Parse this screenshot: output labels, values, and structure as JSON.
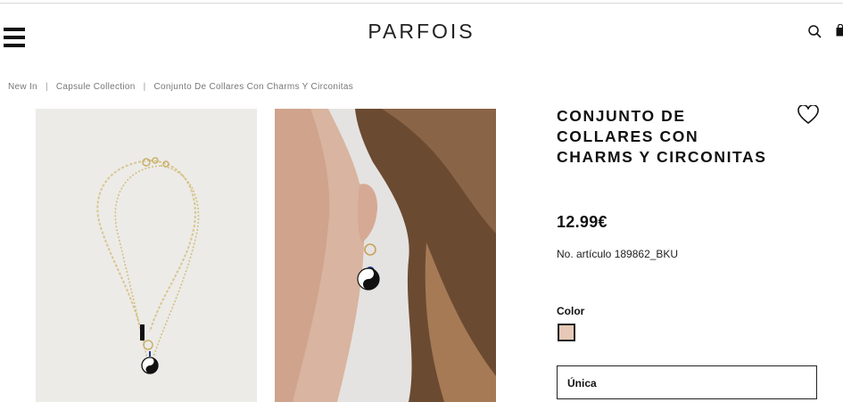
{
  "header": {
    "logo": "PARFOIS",
    "menu_icon": "hamburger-menu-icon",
    "search_icon": "search-icon",
    "bag_icon": "shopping-bag-icon"
  },
  "breadcrumb": [
    "New In",
    "Capsule Collection",
    "Conjunto De Collares Con Charms Y Circonitas"
  ],
  "product": {
    "title": "CONJUNTO DE COLLARES CON CHARMS Y CIRCONITAS",
    "price": "12.99€",
    "sku": "No. artículo 189862_BKU",
    "color_label": "Color",
    "color_swatch": "#e6c9b6",
    "size_selected": "Única",
    "wishlist_icon": "heart-outline-icon"
  }
}
